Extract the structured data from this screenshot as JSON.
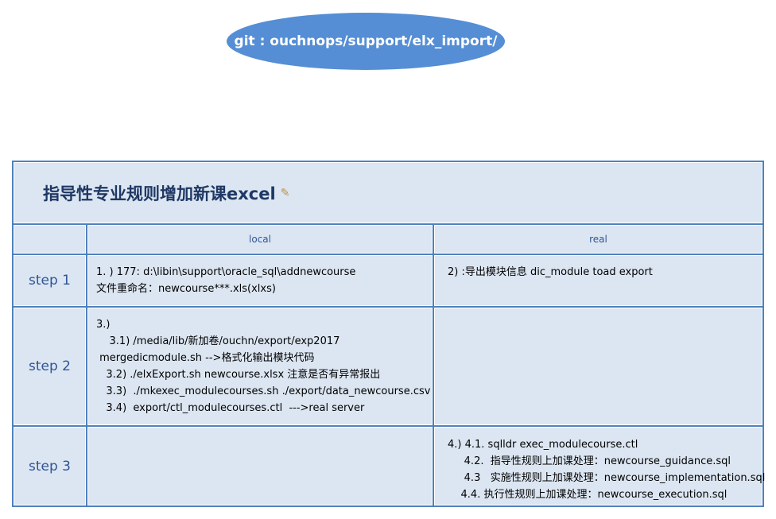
{
  "git_label": "git : ouchnops/support/elx_import/",
  "table": {
    "title": "指导性专业规则增加新课excel",
    "title_icon": "memo-icon",
    "columns": [
      "local",
      "real"
    ],
    "rows": [
      {
        "step": "step 1",
        "local": [
          "1. ) 177: d:\\libin\\support\\oracle_sql\\addnewcourse",
          "文件重命名：newcourse***.xls(xlxs)"
        ],
        "real": [
          "2) :导出模块信息 dic_module toad export"
        ]
      },
      {
        "step": "step 2",
        "local": [
          "3.)",
          "    3.1) /media/lib/新加卷/ouchn/export/exp2017",
          " mergedicmodule.sh -->格式化输出模块代码",
          "   3.2) ./elxExport.sh newcourse.xlsx 注意是否有异常报出",
          "   3.3)  ./mkexec_modulecourses.sh ./export/data_newcourse.csv",
          "   3.4)  export/ctl_modulecourses.ctl  --->real server"
        ],
        "real": []
      },
      {
        "step": "step 3",
        "local": [],
        "real": [
          "4.) 4.1. sqlldr exec_modulecourse.ctl",
          "     4.2.  指导性规则上加课处理：newcourse_guidance.sql",
          "     4.3   实施性规则上加课处理：newcourse_implementation.sql",
          "    4.4. 执行性规则上加课处理：newcourse_execution.sql"
        ]
      }
    ]
  }
}
